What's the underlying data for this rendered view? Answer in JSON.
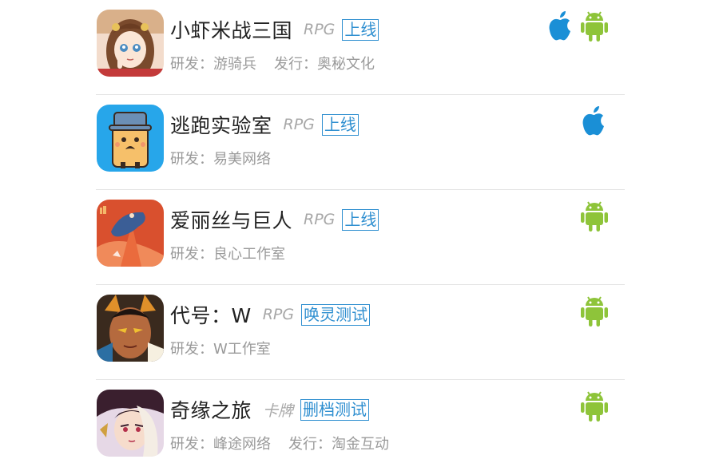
{
  "games": [
    {
      "name": "小虾米战三国",
      "genre": "RPG",
      "status": "上线",
      "developer": "研发：游骑兵",
      "publisher": "发行：奥秘文化",
      "platforms": [
        "apple-icon",
        "android-icon"
      ],
      "thumb": "anime-girl-thumbnail"
    },
    {
      "name": "逃跑实验室",
      "genre": "RPG",
      "status": "上线",
      "developer": "研发：易美网络",
      "publisher": "",
      "platforms": [
        "apple-icon"
      ],
      "thumb": "cartoon-character-thumbnail"
    },
    {
      "name": "爱丽丝与巨人",
      "genre": "RPG",
      "status": "上线",
      "developer": "研发：良心工作室",
      "publisher": "",
      "platforms": [
        "android-icon"
      ],
      "thumb": "orange-art-thumbnail"
    },
    {
      "name": "代号：W",
      "genre": "RPG",
      "status": "唤灵测试",
      "developer": "研发：W工作室",
      "publisher": "",
      "platforms": [
        "android-icon"
      ],
      "thumb": "warrior-thumbnail"
    },
    {
      "name": "奇缘之旅",
      "genre": "卡牌",
      "status": "删档测试",
      "developer": "研发：峰途网络",
      "publisher": "发行：淘金互动",
      "platforms": [
        "android-icon"
      ],
      "thumb": "fantasy-girl-thumbnail"
    }
  ],
  "colors": {
    "apple": "#1a8fd6",
    "android": "#8ec43a",
    "status": "#2f8fd0"
  }
}
